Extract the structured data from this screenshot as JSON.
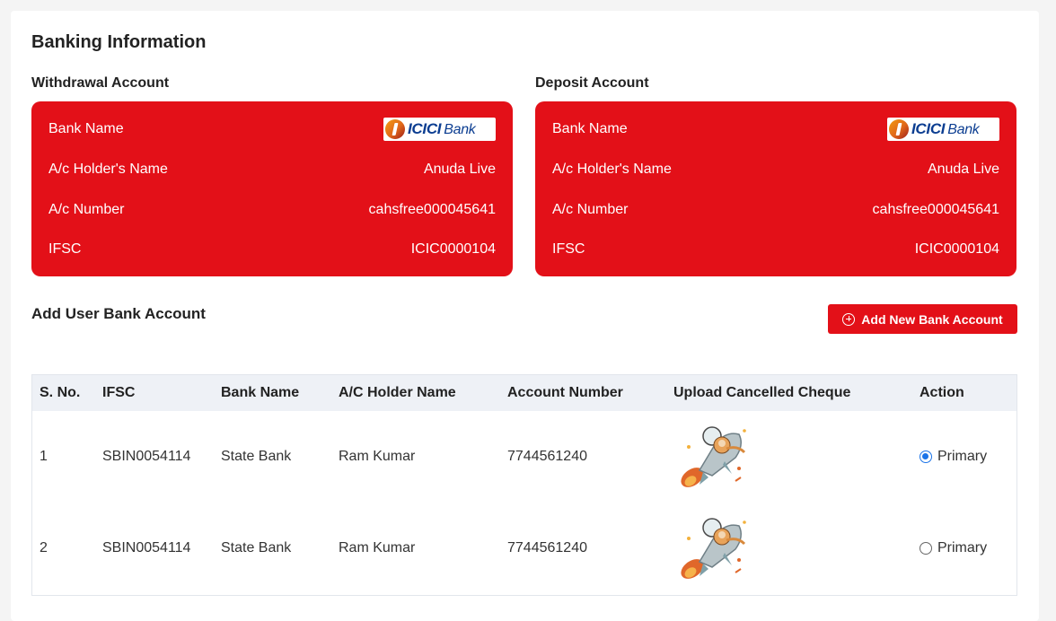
{
  "page": {
    "title": "Banking Information"
  },
  "withdrawal": {
    "label": "Withdrawal Account",
    "bank_label": "Bank Name",
    "bank_logo": "ICICI Bank",
    "holder_label": "A/c Holder's Name",
    "holder_value": "Anuda Live",
    "number_label": "A/c Number",
    "number_value": "cahsfree000045641",
    "ifsc_label": "IFSC",
    "ifsc_value": "ICIC0000104"
  },
  "deposit": {
    "label": "Deposit Account",
    "bank_label": "Bank Name",
    "bank_logo": "ICICI Bank",
    "holder_label": "A/c Holder's Name",
    "holder_value": "Anuda Live",
    "number_label": "A/c Number",
    "number_value": "cahsfree000045641",
    "ifsc_label": "IFSC",
    "ifsc_value": "ICIC0000104"
  },
  "user_bank": {
    "title": "Add User Bank Account",
    "add_button": "Add New Bank Account",
    "add_icon": "plus-circle-icon"
  },
  "table": {
    "headers": [
      "S. No.",
      "IFSC",
      "Bank Name",
      "A/C Holder Name",
      "Account Number",
      "Upload Cancelled Cheque",
      "Action"
    ],
    "rows": [
      {
        "sno": "1",
        "ifsc": "SBIN0054114",
        "bank": "State Bank",
        "holder": "Ram Kumar",
        "account": "7744561240",
        "cheque_image": "rocket-illustration",
        "action": "Primary",
        "selected": true
      },
      {
        "sno": "2",
        "ifsc": "SBIN0054114",
        "bank": "State Bank",
        "holder": "Ram Kumar",
        "account": "7744561240",
        "cheque_image": "rocket-illustration",
        "action": "Primary",
        "selected": false
      }
    ]
  },
  "colors": {
    "accent": "#e31018",
    "radio": "#1a73e8",
    "table_header": "#eef1f6"
  }
}
